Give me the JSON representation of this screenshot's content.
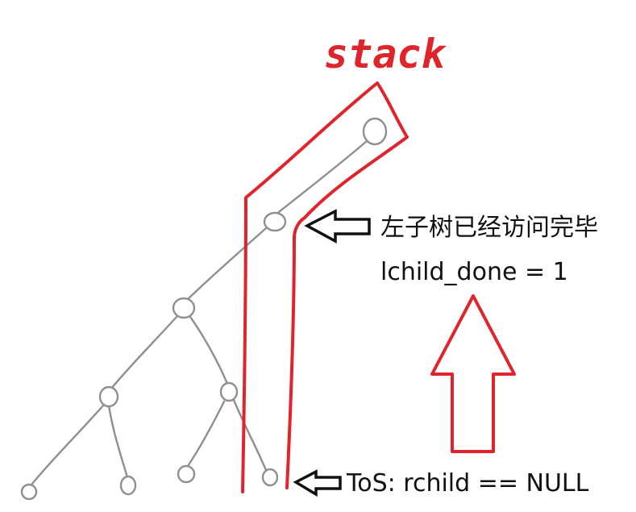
{
  "title": "stack",
  "annotations": {
    "left_subtree_visited": "左子树已经访问完毕",
    "lchild_done": "lchild_done = 1",
    "top_of_stack": "ToS: rchild == NULL"
  },
  "colors": {
    "stack": "#e0242b",
    "tree": "#8f8f8f",
    "text": "#111111"
  }
}
